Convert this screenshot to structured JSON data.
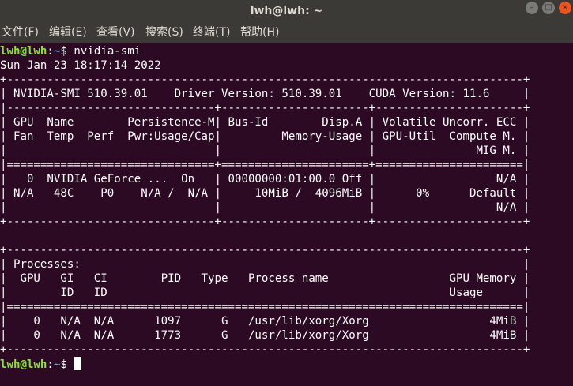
{
  "window": {
    "title": "lwh@lwh: ~",
    "controls": {
      "minimize": "–",
      "maximize": "□",
      "close": "×"
    }
  },
  "menu": {
    "file": "文件(F)",
    "edit": "编辑(E)",
    "view": "查看(V)",
    "search": "搜索(S)",
    "terminal": "终端(T)",
    "help": "帮助(H)"
  },
  "terminal": {
    "prompt_user": "lwh@lwh",
    "prompt_sep": ":",
    "prompt_path": "~",
    "prompt_end": "$ ",
    "command": "nvidia-smi",
    "date_line": "Sun Jan 23 18:17:14 2022",
    "lines": [
      "+-----------------------------------------------------------------------------+",
      "| NVIDIA-SMI 510.39.01    Driver Version: 510.39.01    CUDA Version: 11.6     |",
      "|-------------------------------+----------------------+----------------------+",
      "| GPU  Name        Persistence-M| Bus-Id        Disp.A | Volatile Uncorr. ECC |",
      "| Fan  Temp  Perf  Pwr:Usage/Cap|         Memory-Usage | GPU-Util  Compute M. |",
      "|                               |                      |               MIG M. |",
      "|===============================+======================+======================|",
      "|   0  NVIDIA GeForce ...  On   | 00000000:01:00.0 Off |                  N/A |",
      "| N/A   48C    P0    N/A /  N/A |     10MiB /  4096MiB |      0%      Default |",
      "|                               |                      |                  N/A |",
      "+-------------------------------+----------------------+----------------------+",
      "",
      "+-----------------------------------------------------------------------------+",
      "| Processes:                                                                  |",
      "|  GPU   GI   CI        PID   Type   Process name                  GPU Memory |",
      "|        ID   ID                                                   Usage      |",
      "|=============================================================================|",
      "|    0   N/A  N/A      1097      G   /usr/lib/xorg/Xorg                  4MiB |",
      "|    0   N/A  N/A      1773      G   /usr/lib/xorg/Xorg                  4MiB |",
      "+-----------------------------------------------------------------------------+"
    ]
  }
}
